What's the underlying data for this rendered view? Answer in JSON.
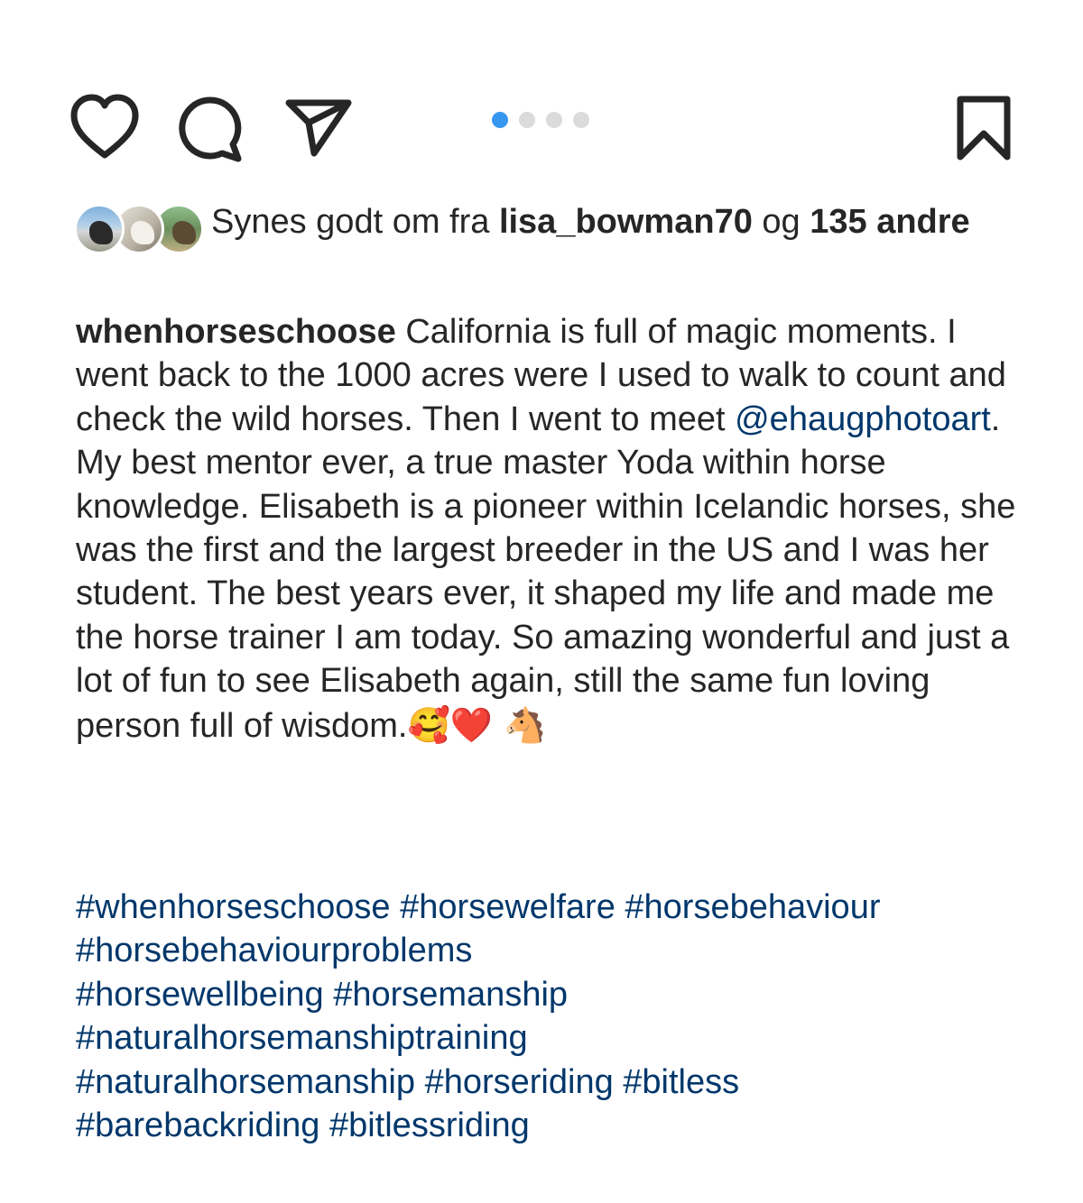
{
  "actions": {
    "like_icon": "heart-outline",
    "comment_icon": "comment-bubble",
    "share_icon": "paper-plane",
    "save_icon": "bookmark-outline"
  },
  "carousel": {
    "count": 4,
    "active_index": 0,
    "active_color": "#3797f0",
    "inactive_color": "#dbdbdb"
  },
  "likes": {
    "prefix": "Synes godt om fra ",
    "user": "lisa_bowman70",
    "middle": " og ",
    "count": "135",
    "suffix": "andre"
  },
  "caption": {
    "username": "whenhorseschoose",
    "text_part1": " California is full of magic moments. I went back to the 1000 acres were I used to walk to count and check the wild horses. Then I went to meet ",
    "mention": "@ehaugphotoart",
    "text_part2": ". My best mentor ever, a true master Yoda within horse knowledge. Elisabeth is a pioneer within Icelandic horses, she was the first and the largest breeder in the US and I was her student. The best years ever, it shaped my life and made me the horse trainer I am today. So amazing wonderful and just a lot of fun to see Elisabeth again, still the same fun loving person full of wisdom.",
    "emojis": "🥰❤️ 🐴"
  },
  "hashtags": [
    "#whenhorseschoose",
    "#horsewelfare",
    "#horsebehaviour",
    "#horsebehaviourproblems",
    "#horsewellbeing",
    "#horsemanship",
    "#naturalhorsemanshiptraining",
    "#naturalhorsemanship",
    "#horseriding",
    "#bitless",
    "#barebackriding",
    "#bitlessriding"
  ],
  "colors": {
    "text": "#262626",
    "link": "#00376b"
  }
}
